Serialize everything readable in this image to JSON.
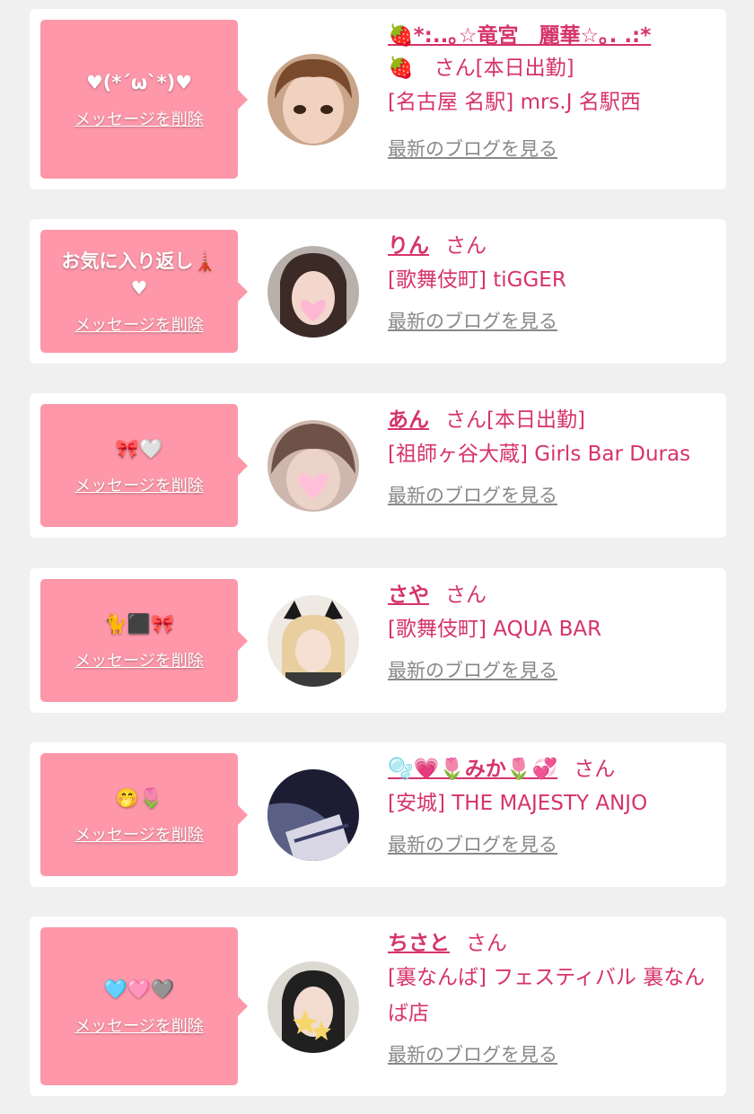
{
  "cards": [
    {
      "message": "♥(*´ω`*)♥",
      "delete_label": "メッセージを削除",
      "name": "🍓*:..｡☆竜宮　麗華☆｡. .:*",
      "san": "🍓　さん[本日出勤]",
      "shop": "[名古屋 名駅] mrs.J 名駅西",
      "blog_label": "最新のブログを見る"
    },
    {
      "message": "お気に入り返し🗼♥",
      "delete_label": "メッセージを削除",
      "name": "りん",
      "san": "さん",
      "shop": "[歌舞伎町] tiGGER",
      "blog_label": "最新のブログを見る"
    },
    {
      "message": "🎀🤍",
      "delete_label": "メッセージを削除",
      "name": "あん",
      "san": "さん[本日出勤]",
      "shop": "[祖師ヶ谷大蔵] Girls Bar Duras",
      "blog_label": "最新のブログを見る"
    },
    {
      "message": "🐈⬛🎀",
      "delete_label": "メッセージを削除",
      "name": "さや",
      "san": "さん",
      "shop": "[歌舞伎町] AQUA BAR",
      "blog_label": "最新のブログを見る"
    },
    {
      "message": "🤭🌷",
      "delete_label": "メッセージを削除",
      "name": "🫧💗🌷みか🌷💞",
      "san": "さん",
      "shop": "[安城] THE MAJESTY ANJO",
      "blog_label": "最新のブログを見る"
    },
    {
      "message": "🩵🩷🩶",
      "delete_label": "メッセージを削除",
      "name": "ちさと",
      "san": "さん",
      "shop": "[裏なんば] フェスティバル 裏なんば店",
      "blog_label": "最新のブログを見る"
    }
  ],
  "colors": {
    "bubble": "#fd97a9",
    "accent": "#d6336c",
    "link_gray": "#888888",
    "background": "#f0f0f0"
  }
}
